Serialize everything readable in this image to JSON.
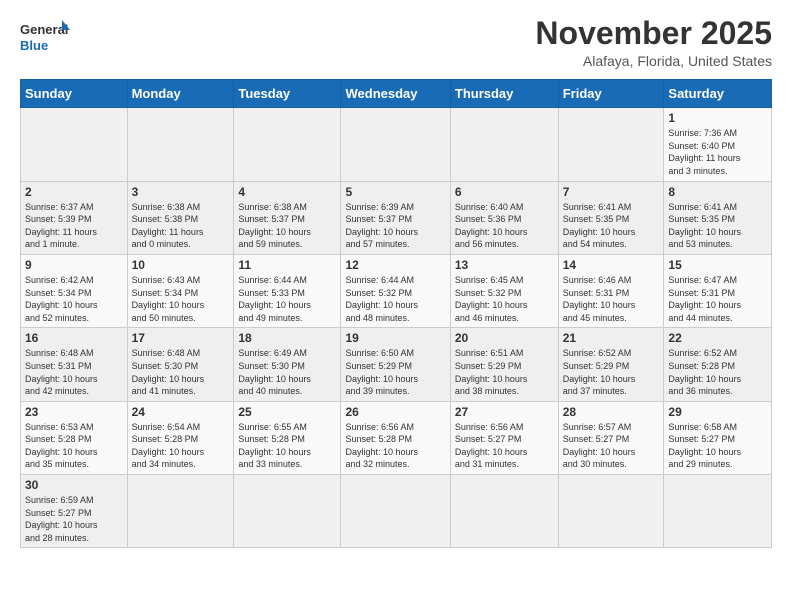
{
  "logo": {
    "text_general": "General",
    "text_blue": "Blue"
  },
  "header": {
    "month_title": "November 2025",
    "location": "Alafaya, Florida, United States"
  },
  "days_of_week": [
    "Sunday",
    "Monday",
    "Tuesday",
    "Wednesday",
    "Thursday",
    "Friday",
    "Saturday"
  ],
  "weeks": [
    [
      {
        "day": "",
        "info": ""
      },
      {
        "day": "",
        "info": ""
      },
      {
        "day": "",
        "info": ""
      },
      {
        "day": "",
        "info": ""
      },
      {
        "day": "",
        "info": ""
      },
      {
        "day": "",
        "info": ""
      },
      {
        "day": "1",
        "info": "Sunrise: 7:36 AM\nSunset: 6:40 PM\nDaylight: 11 hours\nand 3 minutes."
      }
    ],
    [
      {
        "day": "2",
        "info": "Sunrise: 6:37 AM\nSunset: 5:39 PM\nDaylight: 11 hours\nand 1 minute."
      },
      {
        "day": "3",
        "info": "Sunrise: 6:38 AM\nSunset: 5:38 PM\nDaylight: 11 hours\nand 0 minutes."
      },
      {
        "day": "4",
        "info": "Sunrise: 6:38 AM\nSunset: 5:37 PM\nDaylight: 10 hours\nand 59 minutes."
      },
      {
        "day": "5",
        "info": "Sunrise: 6:39 AM\nSunset: 5:37 PM\nDaylight: 10 hours\nand 57 minutes."
      },
      {
        "day": "6",
        "info": "Sunrise: 6:40 AM\nSunset: 5:36 PM\nDaylight: 10 hours\nand 56 minutes."
      },
      {
        "day": "7",
        "info": "Sunrise: 6:41 AM\nSunset: 5:35 PM\nDaylight: 10 hours\nand 54 minutes."
      },
      {
        "day": "8",
        "info": "Sunrise: 6:41 AM\nSunset: 5:35 PM\nDaylight: 10 hours\nand 53 minutes."
      }
    ],
    [
      {
        "day": "9",
        "info": "Sunrise: 6:42 AM\nSunset: 5:34 PM\nDaylight: 10 hours\nand 52 minutes."
      },
      {
        "day": "10",
        "info": "Sunrise: 6:43 AM\nSunset: 5:34 PM\nDaylight: 10 hours\nand 50 minutes."
      },
      {
        "day": "11",
        "info": "Sunrise: 6:44 AM\nSunset: 5:33 PM\nDaylight: 10 hours\nand 49 minutes."
      },
      {
        "day": "12",
        "info": "Sunrise: 6:44 AM\nSunset: 5:32 PM\nDaylight: 10 hours\nand 48 minutes."
      },
      {
        "day": "13",
        "info": "Sunrise: 6:45 AM\nSunset: 5:32 PM\nDaylight: 10 hours\nand 46 minutes."
      },
      {
        "day": "14",
        "info": "Sunrise: 6:46 AM\nSunset: 5:31 PM\nDaylight: 10 hours\nand 45 minutes."
      },
      {
        "day": "15",
        "info": "Sunrise: 6:47 AM\nSunset: 5:31 PM\nDaylight: 10 hours\nand 44 minutes."
      }
    ],
    [
      {
        "day": "16",
        "info": "Sunrise: 6:48 AM\nSunset: 5:31 PM\nDaylight: 10 hours\nand 42 minutes."
      },
      {
        "day": "17",
        "info": "Sunrise: 6:48 AM\nSunset: 5:30 PM\nDaylight: 10 hours\nand 41 minutes."
      },
      {
        "day": "18",
        "info": "Sunrise: 6:49 AM\nSunset: 5:30 PM\nDaylight: 10 hours\nand 40 minutes."
      },
      {
        "day": "19",
        "info": "Sunrise: 6:50 AM\nSunset: 5:29 PM\nDaylight: 10 hours\nand 39 minutes."
      },
      {
        "day": "20",
        "info": "Sunrise: 6:51 AM\nSunset: 5:29 PM\nDaylight: 10 hours\nand 38 minutes."
      },
      {
        "day": "21",
        "info": "Sunrise: 6:52 AM\nSunset: 5:29 PM\nDaylight: 10 hours\nand 37 minutes."
      },
      {
        "day": "22",
        "info": "Sunrise: 6:52 AM\nSunset: 5:28 PM\nDaylight: 10 hours\nand 36 minutes."
      }
    ],
    [
      {
        "day": "23",
        "info": "Sunrise: 6:53 AM\nSunset: 5:28 PM\nDaylight: 10 hours\nand 35 minutes."
      },
      {
        "day": "24",
        "info": "Sunrise: 6:54 AM\nSunset: 5:28 PM\nDaylight: 10 hours\nand 34 minutes."
      },
      {
        "day": "25",
        "info": "Sunrise: 6:55 AM\nSunset: 5:28 PM\nDaylight: 10 hours\nand 33 minutes."
      },
      {
        "day": "26",
        "info": "Sunrise: 6:56 AM\nSunset: 5:28 PM\nDaylight: 10 hours\nand 32 minutes."
      },
      {
        "day": "27",
        "info": "Sunrise: 6:56 AM\nSunset: 5:27 PM\nDaylight: 10 hours\nand 31 minutes."
      },
      {
        "day": "28",
        "info": "Sunrise: 6:57 AM\nSunset: 5:27 PM\nDaylight: 10 hours\nand 30 minutes."
      },
      {
        "day": "29",
        "info": "Sunrise: 6:58 AM\nSunset: 5:27 PM\nDaylight: 10 hours\nand 29 minutes."
      }
    ],
    [
      {
        "day": "30",
        "info": "Sunrise: 6:59 AM\nSunset: 5:27 PM\nDaylight: 10 hours\nand 28 minutes."
      },
      {
        "day": "",
        "info": ""
      },
      {
        "day": "",
        "info": ""
      },
      {
        "day": "",
        "info": ""
      },
      {
        "day": "",
        "info": ""
      },
      {
        "day": "",
        "info": ""
      },
      {
        "day": "",
        "info": ""
      }
    ]
  ]
}
